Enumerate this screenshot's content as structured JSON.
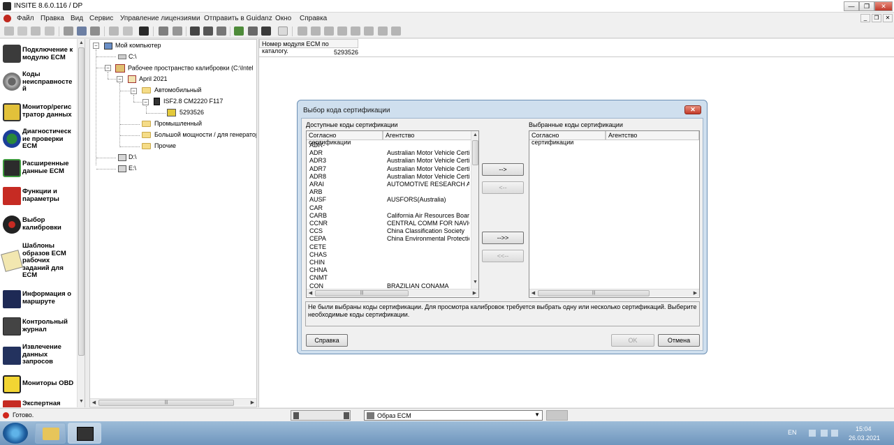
{
  "window": {
    "title": "INSITE 8.6.0.116  / DP",
    "controls": [
      "—",
      "❐",
      "✕"
    ]
  },
  "menu": {
    "items": [
      "Файл",
      "Правка",
      "Вид",
      "Сервис",
      "Управление лицензиями",
      "Отправить в Guidanz",
      "Окно",
      "Справка"
    ],
    "mdi_controls": [
      "_",
      "❐",
      "✕"
    ]
  },
  "toolbar": {
    "icons": [
      "connect-icon",
      "disconnect-icon",
      "ecm-icon",
      "calibration-icon",
      "cut-icon",
      "copy-icon",
      "paste-icon",
      "print-icon",
      "preview-icon",
      "find-icon",
      "refresh-icon",
      "tools-icon",
      "send-icon",
      "receive-icon",
      "save-icon",
      "clear-icon",
      "check-icon",
      "export-icon",
      "filter-icon",
      "properties-icon",
      "record-icon",
      "play-icon",
      "step-icon",
      "pause-icon",
      "stop-icon",
      "chart-icon",
      "log-icon"
    ]
  },
  "nav": {
    "items": [
      {
        "label": "Подключение к модулю ECM",
        "icon": "ecm-connection-icon"
      },
      {
        "label": "Коды неисправносте й",
        "icon": "fault-codes-icon"
      },
      {
        "label": "Монитор/регис тратор данных",
        "icon": "data-monitor-icon"
      },
      {
        "label": "Диагностическ ие проверки ECM",
        "icon": "diagnostic-tests-icon"
      },
      {
        "label": "Расширенные данные ECM",
        "icon": "advanced-data-icon"
      },
      {
        "label": "Функции и параметры",
        "icon": "features-icon"
      },
      {
        "label": "Выбор калибровки",
        "icon": "calibration-select-icon"
      },
      {
        "label": "Шаблоны образов ECM рабочих заданий для ECM",
        "icon": "templates-icon"
      },
      {
        "label": "Информация о маршруте",
        "icon": "trip-info-icon"
      },
      {
        "label": "Контрольный журнал",
        "icon": "audit-trail-icon"
      },
      {
        "label": "Извлечение данных запросов",
        "icon": "data-extraction-icon"
      },
      {
        "label": "Мониторы OBD",
        "icon": "obd-monitor-icon"
      },
      {
        "label": "Экспертная",
        "icon": "expert-icon"
      }
    ]
  },
  "tree": {
    "nodes": [
      {
        "label": "Мой компьютер"
      },
      {
        "label": "C:\\"
      },
      {
        "label": "Рабочее пространство калибровки  (C:\\Intel"
      },
      {
        "label": "April 2021"
      },
      {
        "label": "Автомобильный"
      },
      {
        "label": "ISF2.8 CM2220 F117"
      },
      {
        "label": "5293526"
      },
      {
        "label": "Промышленный"
      },
      {
        "label": "Большой мощности / для генератор"
      },
      {
        "label": "Прочие"
      },
      {
        "label": "D:\\"
      },
      {
        "label": "E:\\"
      }
    ]
  },
  "main": {
    "column_header": "Номер модуля ECM по каталогу.",
    "value": "5293526"
  },
  "dialog": {
    "title": "Выбор кода сертификации",
    "available_label": "Доступные коды сертификации",
    "selected_label": "Выбранные коды сертификации",
    "columns": [
      "Согласно сертификации",
      "Агентство"
    ],
    "available_rows": [
      {
        "code": "ADR-",
        "agency": ""
      },
      {
        "code": "ADR",
        "agency": "Australian Motor Vehicle Certif."
      },
      {
        "code": "ADR3",
        "agency": "Australian Motor Vehicle Certif."
      },
      {
        "code": "ADR7",
        "agency": "Australian Motor Vehicle Certif."
      },
      {
        "code": "ADR8",
        "agency": "Australian Motor Vehicle Certif."
      },
      {
        "code": "ARAI",
        "agency": "AUTOMOTIVE RESEARCH AS"
      },
      {
        "code": "ARB",
        "agency": ""
      },
      {
        "code": "AUSF",
        "agency": "AUSFORS(Australia)"
      },
      {
        "code": "CAR",
        "agency": ""
      },
      {
        "code": "CARB",
        "agency": "California Air Resources Board"
      },
      {
        "code": "CCNR",
        "agency": "CENTRAL COMM FOR NAVIG"
      },
      {
        "code": "CCS",
        "agency": "China Classification Society"
      },
      {
        "code": "CEPA",
        "agency": "China Environmental Protection"
      },
      {
        "code": "CETE",
        "agency": ""
      },
      {
        "code": "CHAS",
        "agency": ""
      },
      {
        "code": "CHIN",
        "agency": ""
      },
      {
        "code": "CHNA",
        "agency": ""
      },
      {
        "code": "CNMT",
        "agency": ""
      },
      {
        "code": "CON",
        "agency": "BRAZILIAN CONAMA"
      }
    ],
    "buttons": {
      "add": "-->",
      "remove": "<--",
      "add_all": "-->>",
      "remove_all": "<<--",
      "help": "Справка",
      "ok": "OK",
      "cancel": "Отмена"
    },
    "message": "Не были выбраны коды сертификации.  Для просмотра калибровок требуется выбрать одну или несколько сертификаций.  Выберите необходимые коды сертификации."
  },
  "status": {
    "text": "Готово.",
    "dropdown_value": "Образ ECM"
  },
  "taskbar": {
    "lang": "EN",
    "time": "15:04",
    "date": "26.03.2021"
  }
}
